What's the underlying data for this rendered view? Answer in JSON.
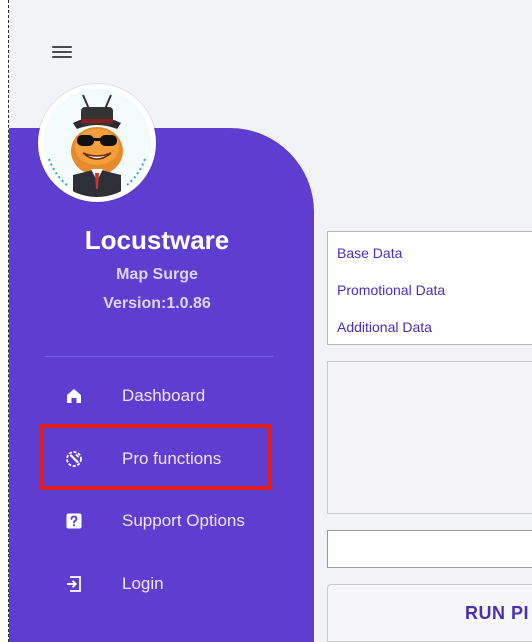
{
  "app": {
    "brand": "Locustware",
    "product": "Map Surge",
    "version": "Version:1.0.86"
  },
  "nav": {
    "items": [
      {
        "label": "Dashboard",
        "icon": "home-icon"
      },
      {
        "label": "Pro functions",
        "icon": "pro-tools-icon"
      },
      {
        "label": "Support Options",
        "icon": "question-mark-icon"
      },
      {
        "label": "Login",
        "icon": "login-icon"
      }
    ],
    "highlighted": "Pro functions"
  },
  "data_panel": {
    "rows": [
      "Base Data",
      "Promotional Data",
      "Additional Data"
    ]
  },
  "input": {
    "value": "",
    "placeholder": ""
  },
  "run_button": {
    "label": "RUN PI"
  },
  "colors": {
    "sidebar": "#5f3dd1",
    "accent_text": "#4a2fb5",
    "highlight_box": "#e01e1e",
    "background": "#f2f3f7"
  }
}
